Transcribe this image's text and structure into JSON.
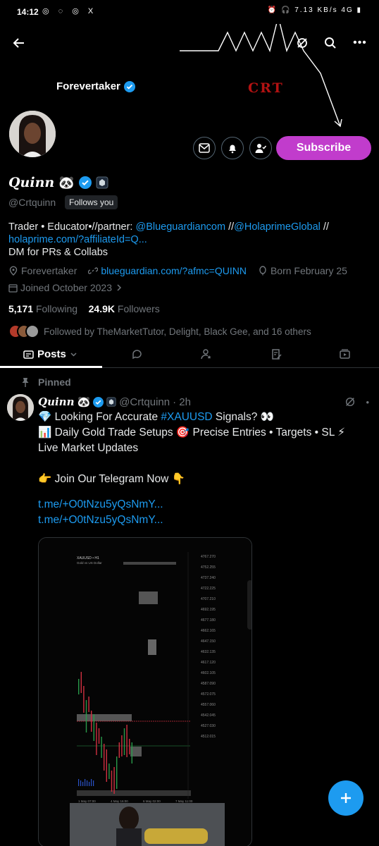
{
  "status_bar": {
    "time": "14:12",
    "left_icons": "◎ ◌ ◎ X",
    "right_icons": "⏰ 🎧 7.13 KB/s 4G ▮"
  },
  "banner": {
    "display_name": "Forevertaker",
    "logo_text": "CRT"
  },
  "profile": {
    "name": "Quinn",
    "handle": "@Crtquinn",
    "follows_you": "Follows you",
    "bio_text": "Trader • Educator•//partner: ",
    "bio_mention1": "@Blueguardiancom",
    "bio_sep": " //",
    "bio_mention2": "@HolaprimeGlobal",
    "bio_sep2": " //",
    "bio_link": "holaprime.com/?affiliateId=Q...",
    "bio_line2": "DM for PRs & Collabs",
    "location": "Forevertaker",
    "website": "blueguardian.com/?afmc=QUINN",
    "birthday": "Born February 25",
    "joined": "Joined October 2023",
    "following_count": "5,171",
    "following_label": "Following",
    "followers_count": "24.9K",
    "followers_label": "Followers",
    "followed_by": "Followed by TheMarketTutor, Delight, Black Gee, and 16 others"
  },
  "actions": {
    "subscribe": "Subscribe"
  },
  "tabs": {
    "posts": "Posts"
  },
  "tweet": {
    "pinned_label": "Pinned",
    "name": "Quinn",
    "handle": "@Crtquinn",
    "time": "· 2h",
    "line1_a": "💎 Looking For Accurate ",
    "line1_hashtag": "#XAUUSD",
    "line1_b": " Signals?  👀",
    "line2": "📊 Daily Gold Trade Setups 🎯 Precise Entries • Targets • SL ⚡",
    "line3": "Live Market Updates",
    "line4": "👉 Join Our Telegram Now 👇",
    "link1": "t.me/+O0tNzu5yQsNmY...",
    "link2": "t.me/+O0tNzu5yQsNmY..."
  },
  "media_chart": {
    "symbol": "XAUUSD • H1",
    "subtitle": "Gold vs US Dollar",
    "price_labels": [
      "4767.270",
      "4752.255",
      "4737.240",
      "4722.225",
      "4707.210",
      "4692.195",
      "4677.180",
      "4662.165",
      "4647.150",
      "4632.135",
      "4617.120",
      "4602.105",
      "4587.090",
      "4572.075",
      "4557.060",
      "4542.045",
      "4527.030",
      "4512.015"
    ],
    "time_labels": [
      "1 May 07:00",
      "4 May 16:00",
      "6 May 02:00",
      "7 May 11:00"
    ]
  },
  "colors": {
    "accent": "#1d9bf0",
    "subscribe": "#c13ccc",
    "crt_red": "#b31212"
  }
}
